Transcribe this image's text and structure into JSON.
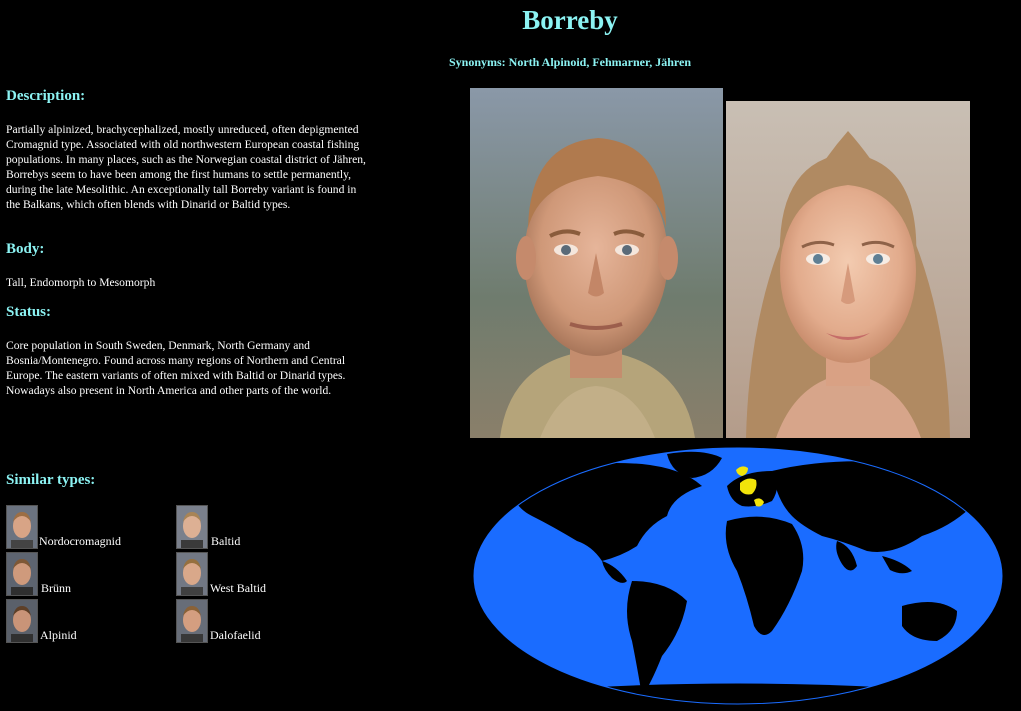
{
  "header": {
    "title": "Borreby",
    "synonyms": "Synonyms: North Alpinoid, Fehmarner, Jähren"
  },
  "description": {
    "heading": "Description:",
    "text": "Partially alpinized, brachycephalized, mostly unreduced, often depigmented Cromagnid type. Associated with old northwestern European coastal fishing populations. In many places, such as the Norwegian coastal district of Jähren, Borrebys seem to have been among the first humans to settle permanently, during the late Mesolithic. An exceptionally tall Borreby variant is found in the Balkans, which often blends with Dinarid or Baltid types."
  },
  "body": {
    "heading": "Body:",
    "text": "Tall, Endomorph to Mesomorph"
  },
  "status": {
    "heading": "Status:",
    "text": "Core population in South Sweden, Denmark, North Germany and Bosnia/Montenegro. Found across many regions of Northern and Central Europe. The eastern variants of often mixed with Baltid or Dinarid types. Nowadays also present in North America and other parts of the world."
  },
  "similar": {
    "heading": "Similar types:",
    "items": [
      {
        "label": "Nordocromagnid"
      },
      {
        "label": "Baltid"
      },
      {
        "label": "Brünn"
      },
      {
        "label": "West Baltid"
      },
      {
        "label": "Alpinid"
      },
      {
        "label": "Dalofaelid"
      }
    ]
  },
  "colors": {
    "heading": "#8cf3f3",
    "background": "#000000",
    "ocean": "#1a6cff",
    "land": "#000000",
    "highlight": "#f2e40a"
  },
  "images": {
    "male_portrait": "male composite face",
    "female_portrait": "female composite face",
    "distribution_map": "world map highlighting Northern and Central Europe"
  }
}
